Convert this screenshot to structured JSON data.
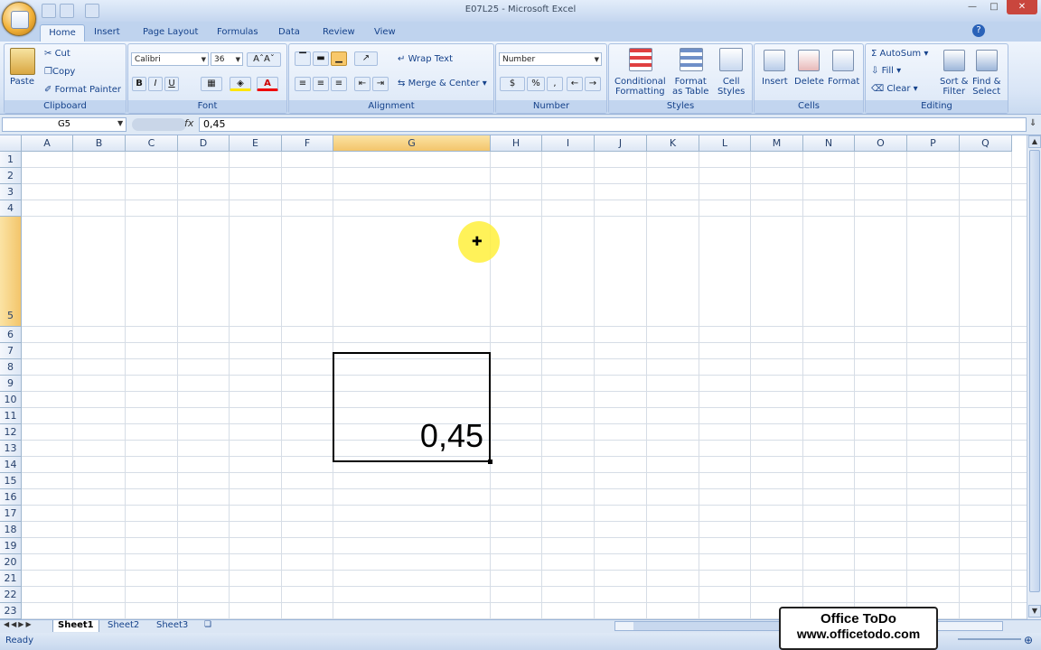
{
  "window": {
    "title": "E07L25 - Microsoft Excel"
  },
  "tabs": [
    "Home",
    "Insert",
    "Page Layout",
    "Formulas",
    "Data",
    "Review",
    "View"
  ],
  "ribbon": {
    "clipboard": {
      "label": "Clipboard",
      "paste": "Paste",
      "cut": "Cut",
      "copy": "Copy",
      "format_painter": "Format Painter"
    },
    "font": {
      "label": "Font",
      "font_name": "Calibri",
      "font_size": "36",
      "bold": "B",
      "italic": "I",
      "underline": "U"
    },
    "alignment": {
      "label": "Alignment",
      "wrap_text": "Wrap Text",
      "merge_center": "Merge & Center"
    },
    "number": {
      "label": "Number",
      "format": "Number",
      "percent": "%",
      "comma": ","
    },
    "styles": {
      "label": "Styles",
      "conditional_formatting": [
        "Conditional",
        "Formatting"
      ],
      "format_as_table": [
        "Format",
        "as Table"
      ],
      "cell_styles": [
        "Cell",
        "Styles"
      ]
    },
    "cells": {
      "label": "Cells",
      "insert": "Insert",
      "delete": "Delete",
      "format": "Format"
    },
    "editing": {
      "label": "Editing",
      "autosum": "AutoSum",
      "fill": "Fill",
      "clear": "Clear",
      "sort_filter": [
        "Sort &",
        "Filter"
      ],
      "find_select": [
        "Find &",
        "Select"
      ]
    }
  },
  "formula_bar": {
    "name_box": "G5",
    "fx": "fx",
    "value": "0,45"
  },
  "columns": [
    "A",
    "B",
    "C",
    "D",
    "E",
    "F",
    "G",
    "H",
    "I",
    "J",
    "K",
    "L",
    "M",
    "N",
    "O",
    "P",
    "Q"
  ],
  "rows": [
    "1",
    "2",
    "3",
    "4",
    "5",
    "6",
    "7",
    "8",
    "9",
    "10",
    "11",
    "12",
    "13",
    "14",
    "15",
    "16",
    "17",
    "18",
    "19",
    "20",
    "21",
    "22",
    "23"
  ],
  "selected_cell": {
    "value": "0,45"
  },
  "sheets": [
    "Sheet1",
    "Sheet2",
    "Sheet3"
  ],
  "status": {
    "text": "Ready"
  },
  "watermark": {
    "line1": "Office ToDo",
    "line2": "www.officetodo.com"
  },
  "colors": {
    "accent": "#15428b",
    "selection": "#f3c56b"
  }
}
